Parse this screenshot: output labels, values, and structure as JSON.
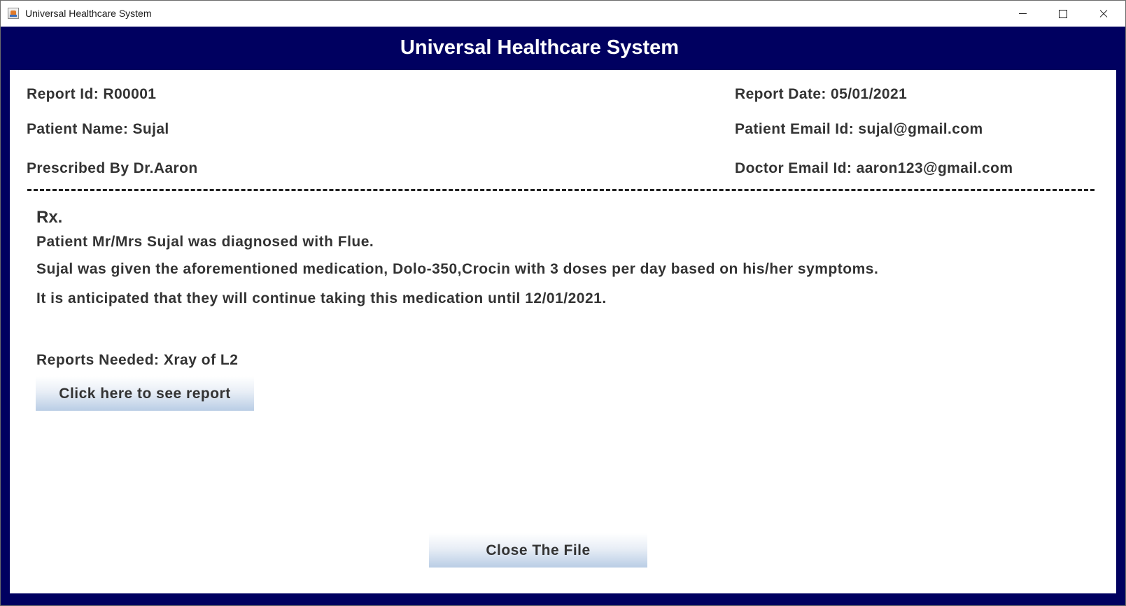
{
  "window": {
    "title": "Universal Healthcare System"
  },
  "header": {
    "title": "Universal Healthcare System"
  },
  "report": {
    "report_id": "Report Id: R00001",
    "report_date": "Report Date: 05/01/2021",
    "patient_name": "Patient Name: Sujal",
    "patient_email": "Patient Email Id: sujal@gmail.com",
    "prescribed_by": "Prescribed By Dr.Aaron",
    "doctor_email": "Doctor Email Id: aaron123@gmail.com"
  },
  "prescription": {
    "title": "Rx.",
    "line1": "Patient Mr/Mrs Sujal was diagnosed with Flue.",
    "line2": "Sujal was given the aforementioned medication, Dolo-350,Crocin with 3 doses per day based on his/her symptoms.",
    "line3": "It is anticipated that they will continue taking this medication until 12/01/2021.",
    "reports_needed": "Reports Needed: Xray of L2"
  },
  "buttons": {
    "see_report": "Click here to see report",
    "close_file": "Close The File"
  },
  "colors": {
    "header_background": "#000060",
    "header_text": "#ffffff",
    "body_text": "#333333",
    "button_gradient_end": "#b9cde5"
  }
}
